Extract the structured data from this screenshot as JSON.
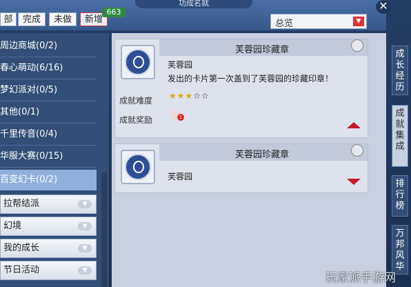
{
  "window": {
    "title": "功成名就",
    "close_icon": "close-icon"
  },
  "filters": [
    {
      "label": "部"
    },
    {
      "label": "完成"
    },
    {
      "label": "未做"
    },
    {
      "label": "新增"
    }
  ],
  "new_count": "663",
  "category_select": {
    "value": "总览"
  },
  "categories": [
    {
      "label": "周边商城(0/2)"
    },
    {
      "label": "春心萌动(6/16)"
    },
    {
      "label": "梦幻派对(0/5)"
    },
    {
      "label": "其他(0/1)"
    },
    {
      "label": "千里传音(0/4)"
    },
    {
      "label": "华服大赛(0/15)"
    },
    {
      "label": "百变幻卡(0/2)"
    }
  ],
  "groups": [
    {
      "label": "拉帮结派"
    },
    {
      "label": "幻境"
    },
    {
      "label": "我的成长"
    },
    {
      "label": "节日活动"
    }
  ],
  "cards": [
    {
      "title": "芙蓉园珍藏章",
      "subtitle": "芙蓉园",
      "description": "发出的卡片第一次盖到了芙蓉园的珍藏印章！",
      "difficulty_label": "成就难度",
      "difficulty_stars": 3,
      "difficulty_max": 5,
      "reward_label": "成就奖励",
      "reward_count": "1"
    },
    {
      "title": "芙蓉园珍藏章",
      "subtitle": "芙蓉园"
    }
  ],
  "side_tabs": [
    {
      "label": "成长经历"
    },
    {
      "label": "成就集成"
    },
    {
      "label": "排行榜"
    },
    {
      "label": "万邦风华"
    }
  ],
  "watermark": "玩家派手游网"
}
